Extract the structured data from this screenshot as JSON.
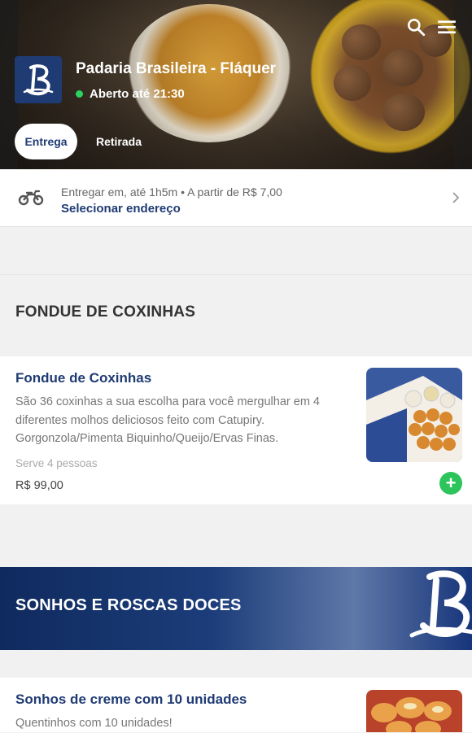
{
  "store": {
    "name": "Padaria Brasileira - Fláquer",
    "status": "Aberto até 21:30"
  },
  "tabs": [
    {
      "label": "Entrega",
      "active": true
    },
    {
      "label": "Retirada",
      "active": false
    }
  ],
  "delivery": {
    "info": "Entregar em, até 1h5m  •  A partir de R$ 7,00",
    "action": "Selecionar endereço"
  },
  "sections": [
    {
      "title": "FONDUE DE COXINHAS",
      "products": [
        {
          "name": "Fondue de Coxinhas",
          "description": "São 36 coxinhas a sua escolha para você mergulhar em 4 diferentes molhos deliciosos feito com Catupiry. Gorgonzola/Pimenta Biquinho/Queijo/Ervas Finas.",
          "serves": "Serve 4 pessoas",
          "price": "R$ 99,00"
        }
      ]
    },
    {
      "title": "SONHOS E ROSCAS DOCES",
      "products": [
        {
          "name": "Sonhos de creme com 10 unidades",
          "description": "Quentinhos com 10 unidades!"
        }
      ]
    }
  ],
  "icons": {
    "search": "search-icon",
    "menu": "menu-icon",
    "moto": "motorcycle-icon",
    "chevron": "chevron-right-icon",
    "add": "plus-icon"
  },
  "colors": {
    "brand_blue": "#1f3b74",
    "open_green": "#2bd260",
    "add_green": "#2cc45b"
  }
}
